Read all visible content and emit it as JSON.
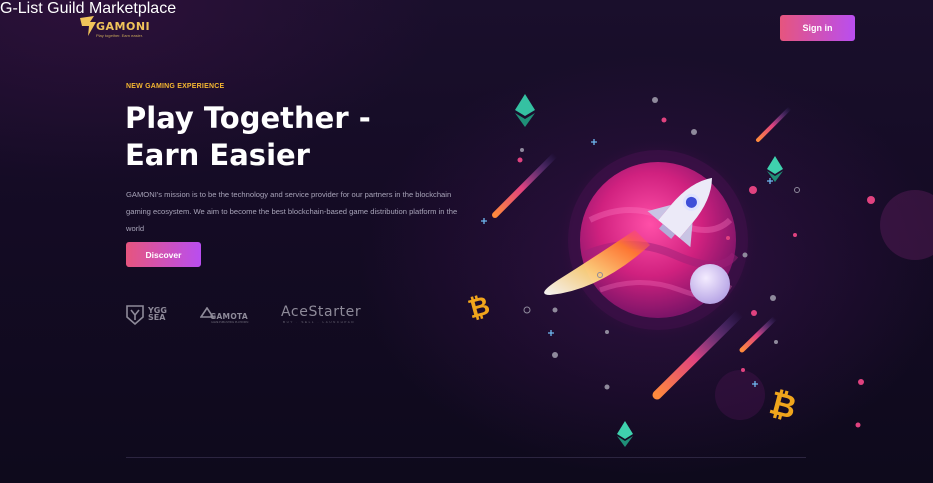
{
  "brand": {
    "name": "GAMONI",
    "tagline": "Play together. Earn easier."
  },
  "nav": {
    "items": [
      {
        "label": "G-List"
      },
      {
        "label": "Guild"
      },
      {
        "label": "Marketplace"
      }
    ],
    "signin_label": "Sign in"
  },
  "hero": {
    "eyebrow": "NEW GAMING EXPERIENCE",
    "title_line1": "Play Together -",
    "title_line2": "Earn Easier",
    "description": "GAMONI's mission is to be the technology and service provider for our partners in the blockchain gaming ecosystem. We aim to become the best blockchain-based game distribution platform in the world",
    "cta_label": "Discover"
  },
  "partners": {
    "ygg": "YGG SEA",
    "gamota": "GAMOTA",
    "gamota_sub": "GAME PUBLISHING PLATFORM",
    "acestarter": "AceStarter",
    "acestarter_sub": "BUY · SELL · LAUNCHPAD"
  },
  "colors": {
    "accent_gradient": [
      "#e6557e",
      "#b94ef0"
    ],
    "eyebrow": "#f5b731",
    "background": "#140b24"
  },
  "icons": [
    "rocket-icon",
    "planet-icon",
    "ethereum-icon",
    "bitcoin-icon",
    "meteor-icon",
    "sparkle-icon"
  ]
}
